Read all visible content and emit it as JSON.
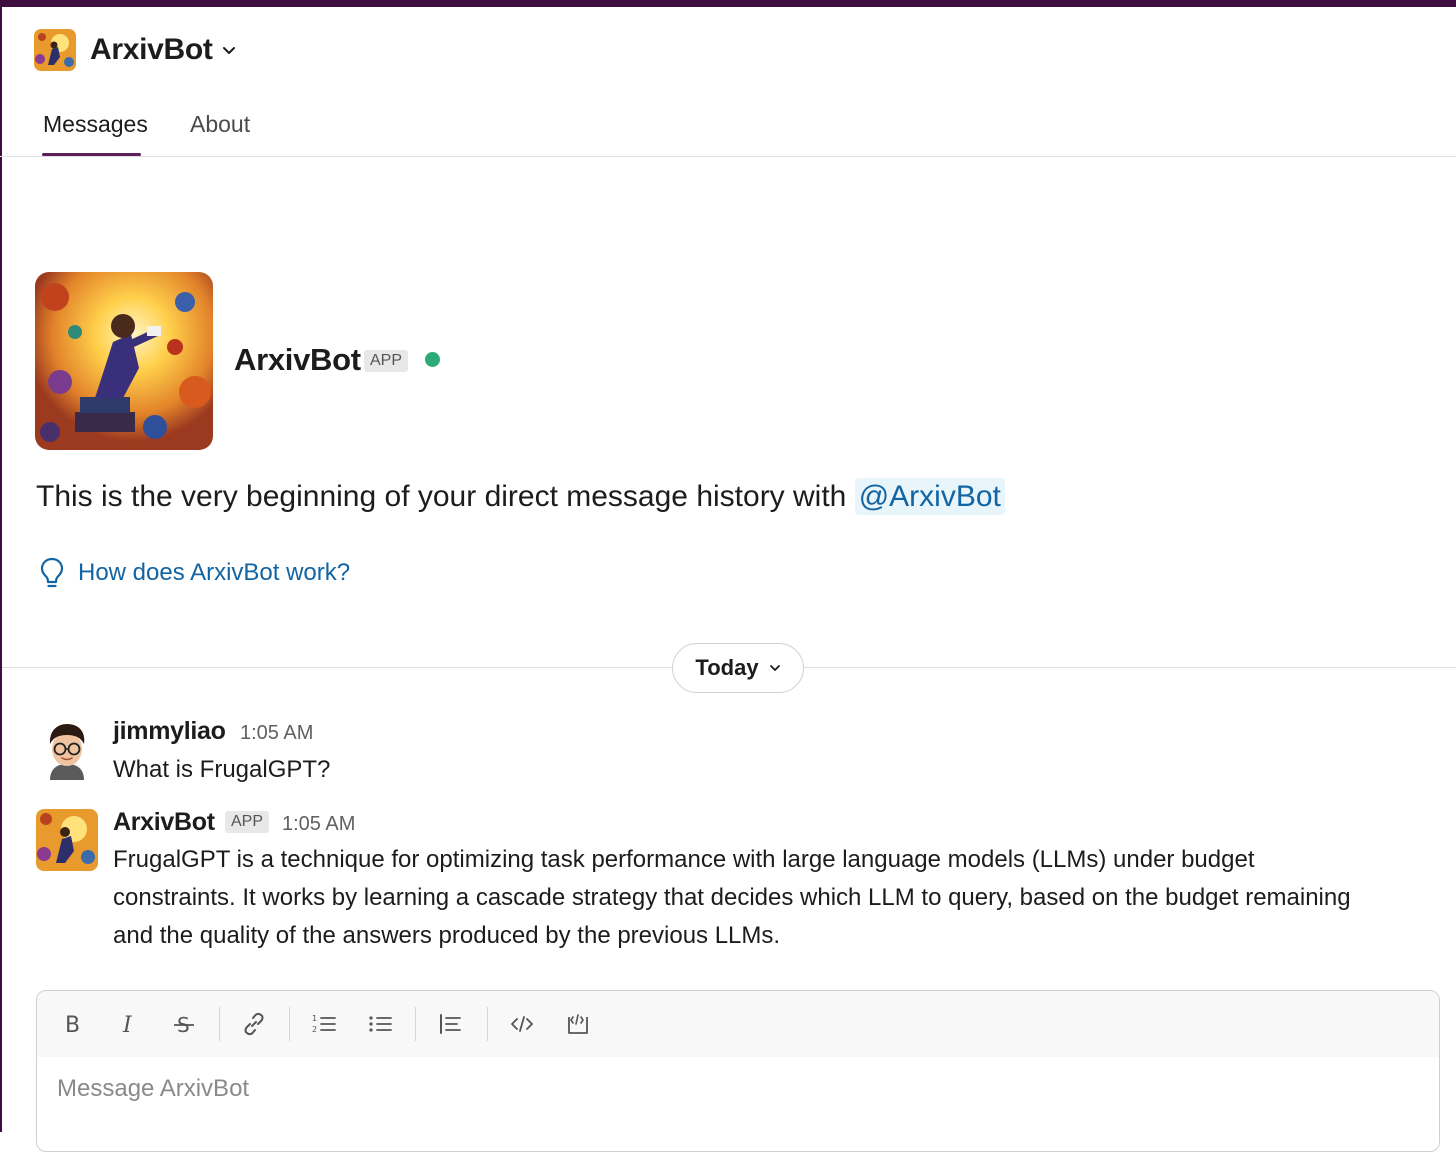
{
  "window": {
    "accent_color": "#3f0e40"
  },
  "header": {
    "title": "ArxivBot",
    "tabs": [
      {
        "label": "Messages",
        "active": true
      },
      {
        "label": "About",
        "active": false
      }
    ]
  },
  "intro": {
    "name": "ArxivBot",
    "badge": "APP",
    "status": "online",
    "text": "This is the very beginning of your direct message history with",
    "mention": "@ArxivBot",
    "help_link": "How does ArxivBot work?"
  },
  "date_divider": {
    "label": "Today"
  },
  "messages": [
    {
      "sender": "jimmyliao",
      "time": "1:05 AM",
      "text": "What is FrugalGPT?"
    },
    {
      "sender": "ArxivBot",
      "badge": "APP",
      "time": "1:05 AM",
      "lines": [
        "FrugalGPT is a technique for optimizing task performance with large language models (LLMs) under budget",
        "constraints. It works by learning a cascade strategy that decides which LLM to query, based on the budget remaining",
        "and the quality of the answers produced by the previous LLMs."
      ]
    }
  ],
  "composer": {
    "placeholder": "Message ArxivBot",
    "toolbar": [
      "bold-icon",
      "italic-icon",
      "strikethrough-icon",
      "link-icon",
      "ordered-list-icon",
      "bulleted-list-icon",
      "blockquote-icon",
      "code-icon",
      "code-block-icon"
    ]
  }
}
